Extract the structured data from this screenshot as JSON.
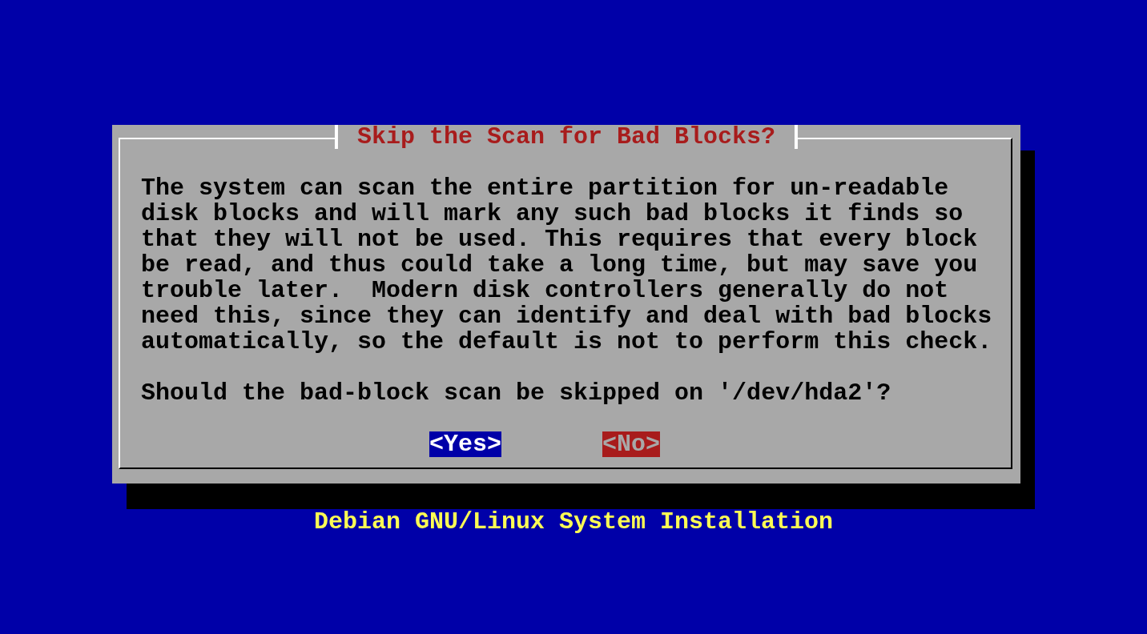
{
  "dialog": {
    "title": "Skip the Scan for Bad Blocks?",
    "message": "The system can scan the entire partition for un-readable\ndisk blocks and will mark any such bad blocks it finds so\nthat they will not be used. This requires that every block\nbe read, and thus could take a long time, but may save you\ntrouble later.  Modern disk controllers generally do not\nneed this, since they can identify and deal with bad blocks\nautomatically, so the default is not to perform this check.",
    "question": "Should the bad-block scan be skipped on '/dev/hda2'?",
    "buttons": [
      {
        "label": "<Yes>",
        "selected": true
      },
      {
        "label": "<No>",
        "selected": false
      }
    ]
  },
  "footer": "Debian GNU/Linux System Installation"
}
